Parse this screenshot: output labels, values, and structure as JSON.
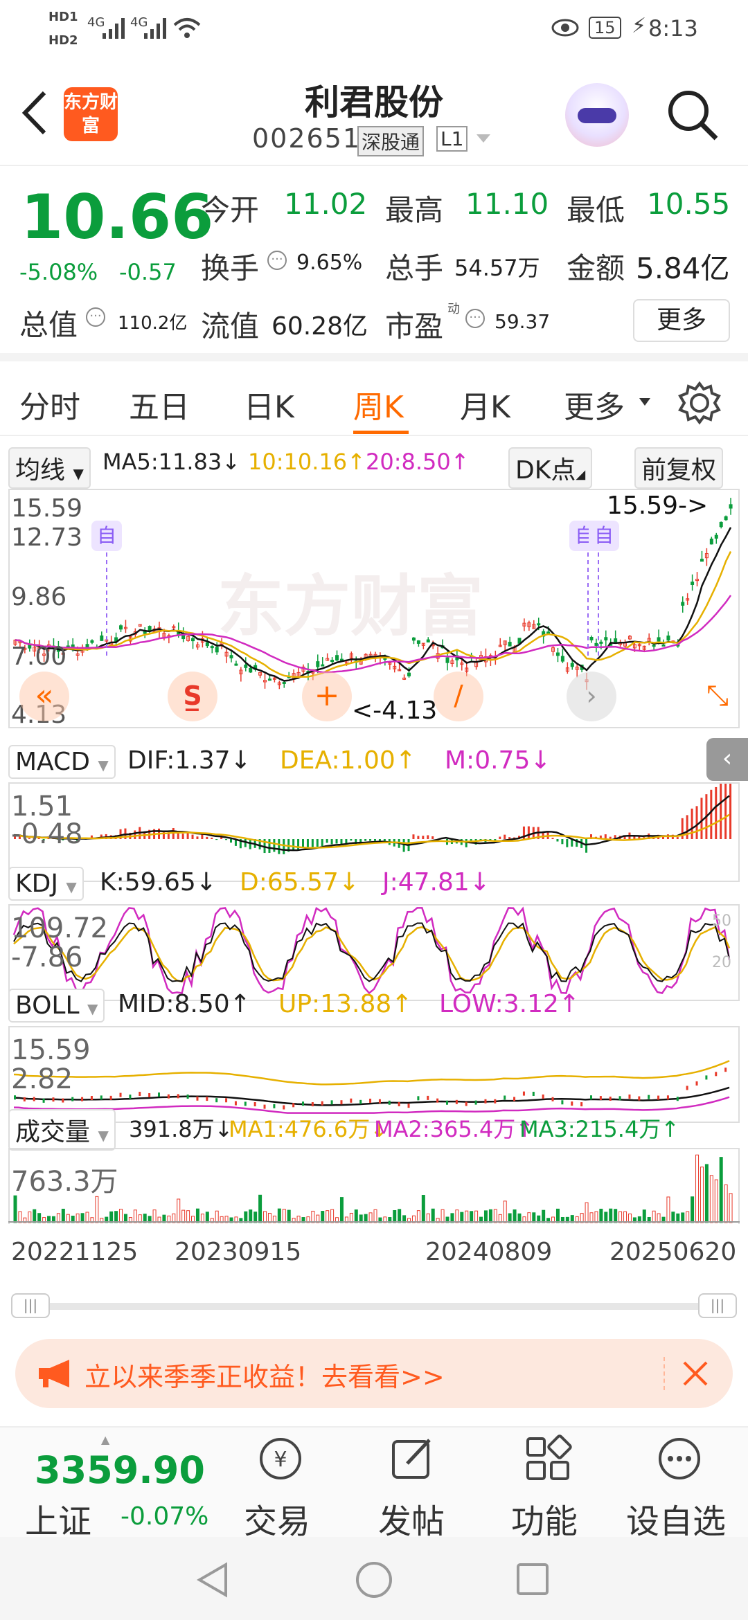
{
  "status": {
    "hd1": "HD1",
    "hd2": "HD2",
    "signal1": "4G",
    "signal2": "4G",
    "battery": "15",
    "time": "8:13"
  },
  "header": {
    "logo": "东方财富",
    "title": "利君股份",
    "code": "002651",
    "market_tag": "深股通",
    "level_tag": "L1"
  },
  "quote": {
    "price": "10.66",
    "change_pct": "-5.08%",
    "change": "-0.57",
    "open_label": "今开",
    "open": "11.02",
    "high_label": "最高",
    "high": "11.10",
    "low_label": "最低",
    "low": "10.55",
    "turnover_label": "换手",
    "turnover": "9.65%",
    "volume_label": "总手",
    "volume": "54.57万",
    "amount_label": "金额",
    "amount": "5.84亿",
    "cap_label": "总值",
    "cap": "110.2亿",
    "float_label": "流值",
    "float_cap": "60.28亿",
    "pe_label": "市盈",
    "pe_sup": "动",
    "pe": "59.37",
    "more_label": "更多"
  },
  "tabs": [
    "分时",
    "五日",
    "日K",
    "周K",
    "月K",
    "更多"
  ],
  "kline": {
    "ma_select": "均线",
    "ma5": "MA5:11.83↓",
    "ma10": "10:10.16↑",
    "ma20": "20:8.50↑",
    "dk": "DK点",
    "adjust": "前复权",
    "watermark": "东方财富",
    "y_labels": [
      "15.59",
      "12.73",
      "9.86",
      "7.00",
      "4.13"
    ],
    "max_note": "15.59->",
    "min_note": "<-4.13",
    "self_tag": "自"
  },
  "macd": {
    "name": "MACD",
    "dif": "DIF:1.37↓",
    "dea": "DEA:1.00↑",
    "m": "M:0.75↓",
    "y_top": "1.51",
    "y_bot": "-0.48"
  },
  "kdj": {
    "name": "KDJ",
    "k": "K:59.65↓",
    "d": "D:65.57↓",
    "j": "J:47.81↓",
    "y_top": "109.72",
    "y_bot": "-7.86",
    "r1": "50",
    "r2": "20"
  },
  "boll": {
    "name": "BOLL",
    "mid": "MID:8.50↑",
    "up": "UP:13.88↑",
    "low": "LOW:3.12↑",
    "y_top": "15.59",
    "y_bot": "2.82"
  },
  "vol": {
    "name": "成交量",
    "val": "391.8万↓",
    "ma1": "MA1:476.6万↓",
    "ma2": "MA2:365.4万↑",
    "ma3": "MA3:215.4万↑",
    "y_top": "763.3万"
  },
  "dates": [
    "20221125",
    "20230915",
    "20240809",
    "20250620"
  ],
  "banner": {
    "text": "成立以来季季正收益！去看看>>"
  },
  "bottom": {
    "index_value": "3359.90",
    "index_name": "上证",
    "index_change": "-0.07%",
    "trade": "交易",
    "post": "发帖",
    "func": "功能",
    "watch": "设自选"
  },
  "colors": {
    "accent": "#ff6a00",
    "up": "#e8392a",
    "down": "#0b9d3c"
  }
}
